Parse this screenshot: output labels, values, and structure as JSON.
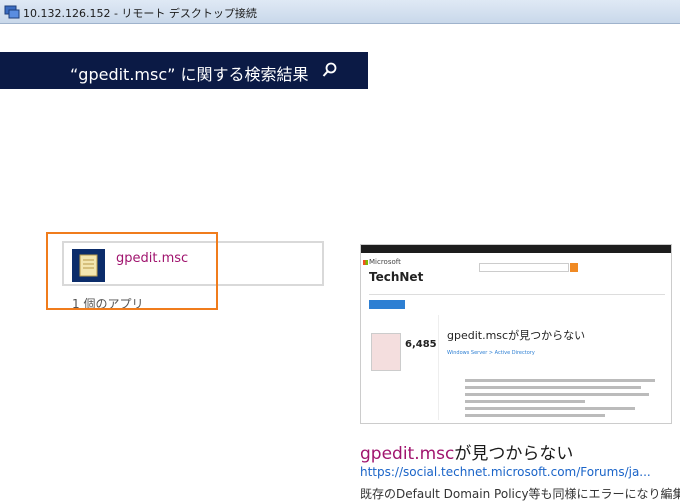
{
  "window": {
    "title": "10.132.126.152 - リモート デスクトップ接続"
  },
  "search": {
    "heading": "“gpedit.msc” に関する検索結果"
  },
  "apps": {
    "item_label": "gpedit.msc",
    "count_label": "1 個のアプリ"
  },
  "web_result": {
    "thumbnail": {
      "brand": "TechNet",
      "company": "Microsoft",
      "question_title": "gpedit.mscが見つからない",
      "score": "6,485",
      "breadcrumb": "Windows Server > Active Directory"
    },
    "title_highlight": "gpedit.msc",
    "title_rest": "が見つからない",
    "url": "https://social.technet.microsoft.com/Forums/ja...",
    "snippet": "既存のDefault Domain Policy等も同様にエラーになり編集"
  },
  "colors": {
    "accent": "#0b1a45",
    "highlight": "#f07c1c",
    "match": "#a0146e",
    "link": "#1a64c8"
  }
}
